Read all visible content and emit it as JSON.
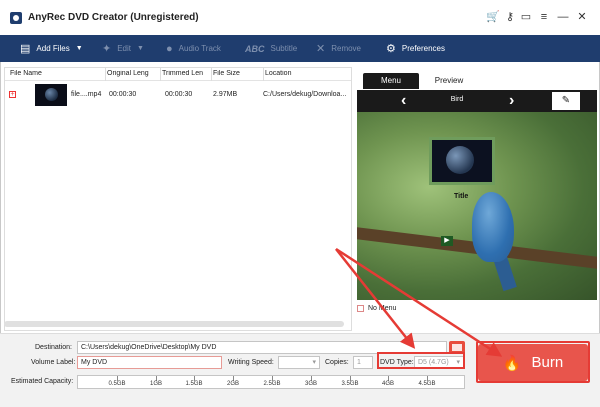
{
  "window": {
    "title": "AnyRec DVD Creator (Unregistered)",
    "icons": [
      "cart-icon",
      "key-icon",
      "feedback-icon",
      "menu-icon",
      "minimize-icon",
      "close-icon"
    ]
  },
  "toolbar": {
    "add_files": "Add Files",
    "edit": "Edit",
    "audio_track": "Audio Track",
    "subtitle": "Subtitle",
    "remove": "Remove",
    "preferences": "Preferences"
  },
  "file_list": {
    "columns": [
      "File Name",
      "Original Leng",
      "Trimmed Len",
      "File Size",
      "Location"
    ],
    "rows": [
      {
        "name": "file....mp4",
        "original": "00:00:30",
        "trimmed": "00:00:30",
        "size": "2.97MB",
        "location": "C:/Users/dekug/Downloa..."
      }
    ]
  },
  "preview": {
    "tabs": [
      "Menu",
      "Preview"
    ],
    "active_tab": "Menu",
    "template_name": "Bird",
    "menu_title": "Title",
    "no_menu_label": "No Menu"
  },
  "settings": {
    "destination_label": "Destination:",
    "destination_value": "C:\\Users\\dekug\\OneDrive\\Desktop\\My DVD",
    "volume_label": "Volume Label:",
    "volume_value": "My DVD",
    "writing_speed_label": "Writing Speed:",
    "copies_label": "Copies:",
    "copies_value": "1",
    "dvd_type_label": "DVD Type:",
    "dvd_type_value": "D5 (4.7G)",
    "capacity_label": "Estimated Capacity:",
    "capacity_ticks": [
      "0.5GB",
      "1GB",
      "1.5GB",
      "2GB",
      "2.5GB",
      "3GB",
      "3.5GB",
      "4GB",
      "4.5GB"
    ]
  },
  "burn_button": "Burn",
  "colors": {
    "toolbar_bg": "#1f3d6e",
    "accent_red": "#e8554c",
    "annotation_red": "#e53b35"
  }
}
